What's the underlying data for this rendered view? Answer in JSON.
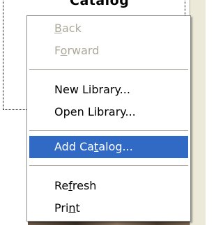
{
  "background": {
    "panel_title": "Catalog"
  },
  "context_menu": {
    "items": [
      {
        "id": "back",
        "pre": "",
        "ul": "B",
        "post": "ack",
        "enabled": false
      },
      {
        "id": "forward",
        "pre": "F",
        "ul": "o",
        "post": "rward",
        "enabled": false
      },
      {
        "id": "new-library",
        "pre": "New Library...",
        "ul": "",
        "post": "",
        "enabled": true
      },
      {
        "id": "open-library",
        "pre": "Open Library...",
        "ul": "",
        "post": "",
        "enabled": true
      },
      {
        "id": "add-catalog",
        "pre": "Add Ca",
        "ul": "t",
        "post": "alog...",
        "enabled": true,
        "selected": true
      },
      {
        "id": "refresh",
        "pre": "Re",
        "ul": "f",
        "post": "resh",
        "enabled": true
      },
      {
        "id": "print",
        "pre": "Pri",
        "ul": "n",
        "post": "t",
        "enabled": true
      }
    ]
  },
  "colors": {
    "selection": "#316ac5",
    "disabled_text": "#aca899",
    "separator": "#aca899"
  }
}
